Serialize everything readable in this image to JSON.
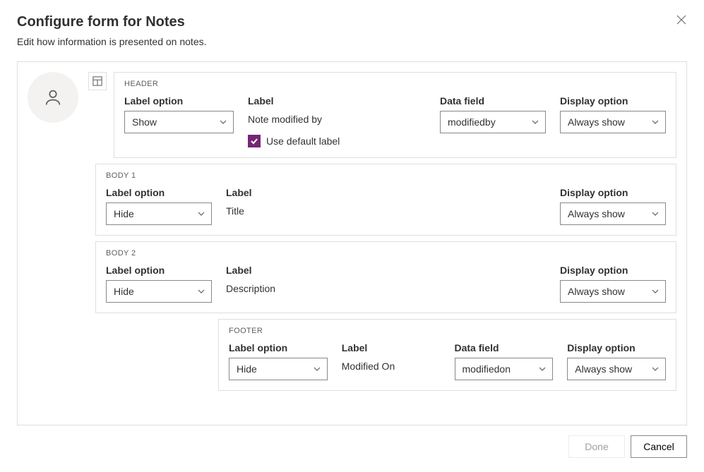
{
  "dialog": {
    "title": "Configure form for Notes",
    "subtitle": "Edit how information is presented on notes."
  },
  "labels": {
    "labelOption": "Label option",
    "label": "Label",
    "dataField": "Data field",
    "displayOption": "Display option"
  },
  "header": {
    "sectionTitle": "HEADER",
    "labelOptionValue": "Show",
    "labelValue": "Note modified by",
    "useDefaultLabelText": "Use default label",
    "useDefaultLabelChecked": true,
    "dataFieldValue": "modifiedby",
    "displayOptionValue": "Always show"
  },
  "body1": {
    "sectionTitle": "BODY 1",
    "labelOptionValue": "Hide",
    "labelValue": "Title",
    "displayOptionValue": "Always show"
  },
  "body2": {
    "sectionTitle": "BODY 2",
    "labelOptionValue": "Hide",
    "labelValue": "Description",
    "displayOptionValue": "Always show"
  },
  "footer": {
    "sectionTitle": "FOOTER",
    "labelOptionValue": "Hide",
    "labelValue": "Modified On",
    "dataFieldValue": "modifiedon",
    "displayOptionValue": "Always show"
  },
  "buttons": {
    "done": "Done",
    "cancel": "Cancel"
  }
}
